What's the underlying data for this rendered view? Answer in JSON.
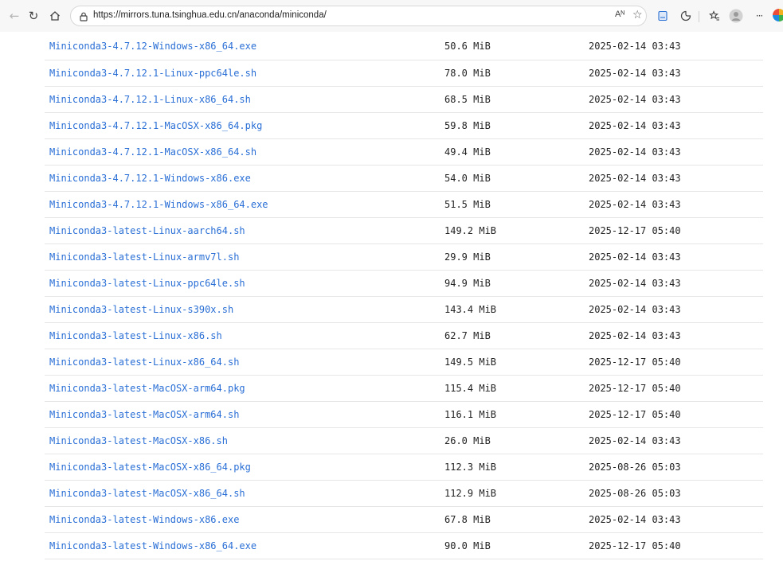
{
  "browser": {
    "url": "https://mirrors.tuna.tsinghua.edu.cn/anaconda/miniconda/",
    "read_aloud_label": "Aᴺ",
    "more_label": "···"
  },
  "files": [
    {
      "name": "Miniconda3-4.7.12-Windows-x86_64.exe",
      "size": "50.6 MiB",
      "date": "2025-02-14 03:43"
    },
    {
      "name": "Miniconda3-4.7.12.1-Linux-ppc64le.sh",
      "size": "78.0 MiB",
      "date": "2025-02-14 03:43"
    },
    {
      "name": "Miniconda3-4.7.12.1-Linux-x86_64.sh",
      "size": "68.5 MiB",
      "date": "2025-02-14 03:43"
    },
    {
      "name": "Miniconda3-4.7.12.1-MacOSX-x86_64.pkg",
      "size": "59.8 MiB",
      "date": "2025-02-14 03:43"
    },
    {
      "name": "Miniconda3-4.7.12.1-MacOSX-x86_64.sh",
      "size": "49.4 MiB",
      "date": "2025-02-14 03:43"
    },
    {
      "name": "Miniconda3-4.7.12.1-Windows-x86.exe",
      "size": "54.0 MiB",
      "date": "2025-02-14 03:43"
    },
    {
      "name": "Miniconda3-4.7.12.1-Windows-x86_64.exe",
      "size": "51.5 MiB",
      "date": "2025-02-14 03:43"
    },
    {
      "name": "Miniconda3-latest-Linux-aarch64.sh",
      "size": "149.2 MiB",
      "date": "2025-12-17 05:40"
    },
    {
      "name": "Miniconda3-latest-Linux-armv7l.sh",
      "size": "29.9 MiB",
      "date": "2025-02-14 03:43"
    },
    {
      "name": "Miniconda3-latest-Linux-ppc64le.sh",
      "size": "94.9 MiB",
      "date": "2025-02-14 03:43"
    },
    {
      "name": "Miniconda3-latest-Linux-s390x.sh",
      "size": "143.4 MiB",
      "date": "2025-02-14 03:43"
    },
    {
      "name": "Miniconda3-latest-Linux-x86.sh",
      "size": "62.7 MiB",
      "date": "2025-02-14 03:43"
    },
    {
      "name": "Miniconda3-latest-Linux-x86_64.sh",
      "size": "149.5 MiB",
      "date": "2025-12-17 05:40"
    },
    {
      "name": "Miniconda3-latest-MacOSX-arm64.pkg",
      "size": "115.4 MiB",
      "date": "2025-12-17 05:40"
    },
    {
      "name": "Miniconda3-latest-MacOSX-arm64.sh",
      "size": "116.1 MiB",
      "date": "2025-12-17 05:40"
    },
    {
      "name": "Miniconda3-latest-MacOSX-x86.sh",
      "size": "26.0 MiB",
      "date": "2025-02-14 03:43"
    },
    {
      "name": "Miniconda3-latest-MacOSX-x86_64.pkg",
      "size": "112.3 MiB",
      "date": "2025-08-26 05:03"
    },
    {
      "name": "Miniconda3-latest-MacOSX-x86_64.sh",
      "size": "112.9 MiB",
      "date": "2025-08-26 05:03"
    },
    {
      "name": "Miniconda3-latest-Windows-x86.exe",
      "size": "67.8 MiB",
      "date": "2025-02-14 03:43"
    },
    {
      "name": "Miniconda3-latest-Windows-x86_64.exe",
      "size": "90.0 MiB",
      "date": "2025-12-17 05:40"
    }
  ],
  "colors": {
    "link": "#2a6fd6",
    "text": "#222222",
    "row_border": "#e6e6e6",
    "chrome_bg": "#f7f7f7"
  },
  "icons": [
    "back-arrow-icon",
    "refresh-icon",
    "home-icon",
    "lock-icon",
    "read-aloud-icon",
    "favorite-star-icon",
    "split-screen-icon",
    "extensions-icon",
    "favorites-icon",
    "profile-icon",
    "more-icon",
    "copilot-icon"
  ]
}
